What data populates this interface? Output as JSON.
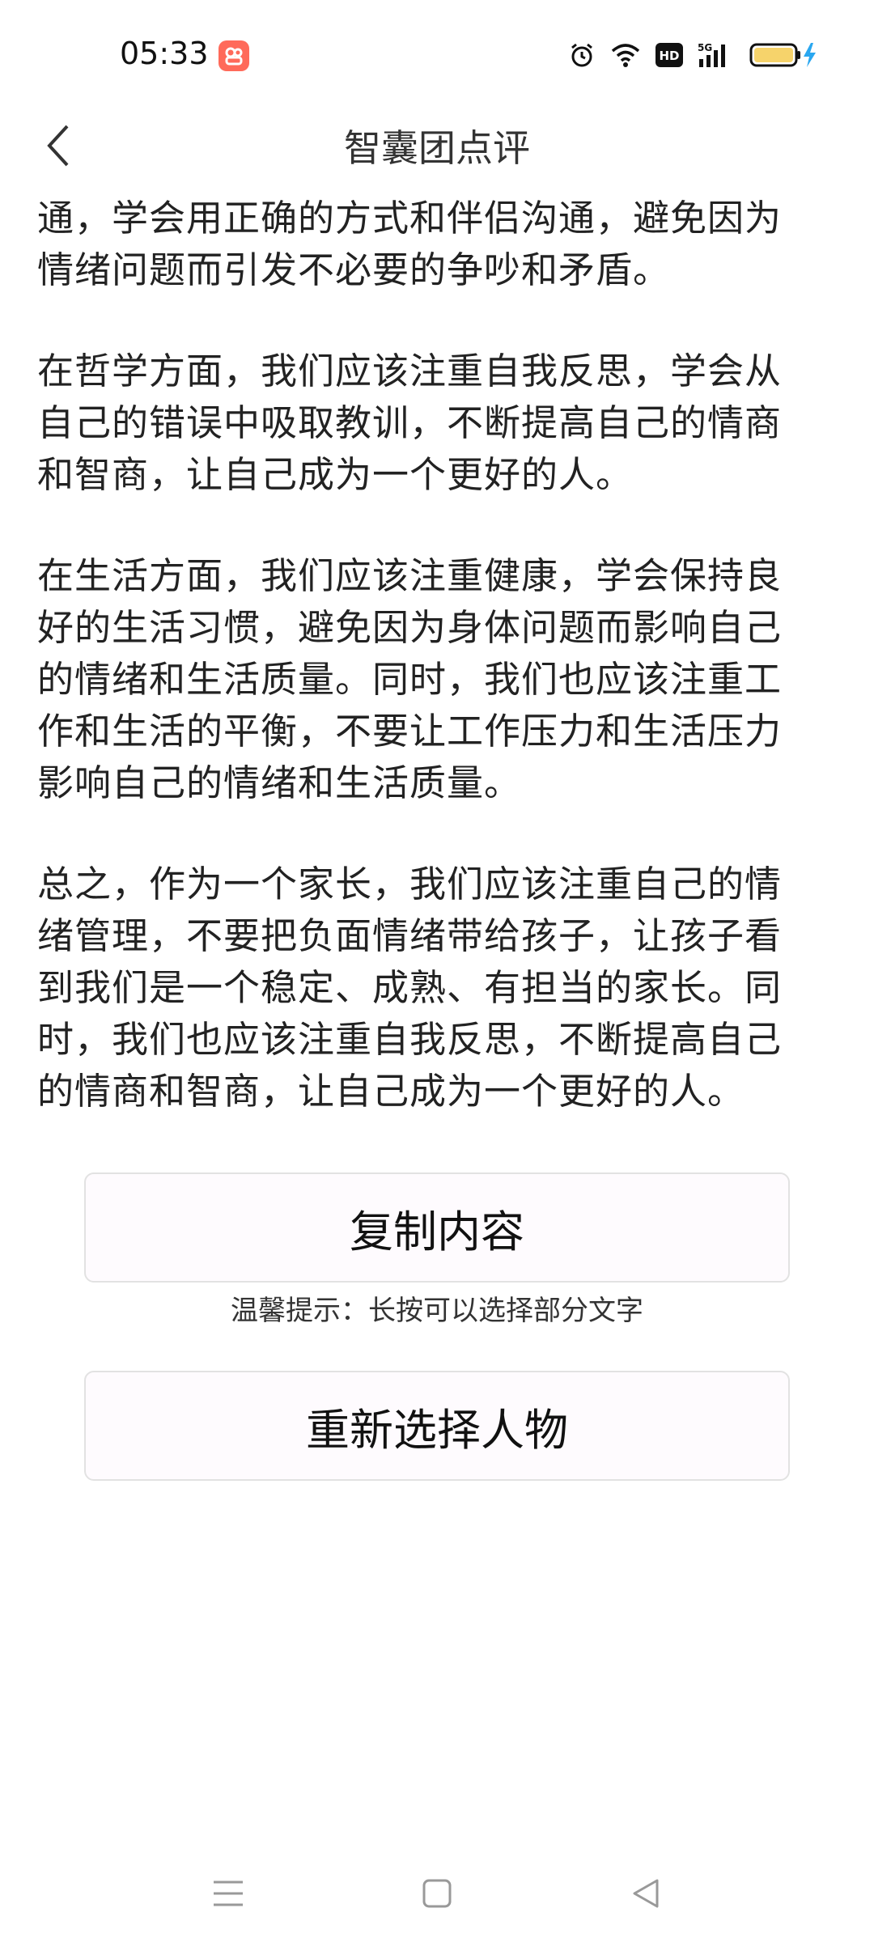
{
  "status_bar": {
    "time": "05:33",
    "network": "5G",
    "hd": "HD",
    "app_badge_color": "#ff6a5a",
    "battery_color": "#f6d36b",
    "charging_color": "#2aa7f0"
  },
  "nav": {
    "title": "智囊团点评"
  },
  "content": {
    "paragraphs": [
      "通，学会用正确的方式和伴侣沟通，避免因为\n情绪问题而引发不必要的争吵和矛盾。",
      "在哲学方面，我们应该注重自我反思，学会从\n自己的错误中吸取教训，不断提高自己的情商\n和智商，让自己成为一个更好的人。",
      "在生活方面，我们应该注重健康，学会保持良\n好的生活习惯，避免因为身体问题而影响自己\n的情绪和生活质量。同时，我们也应该注重工\n作和生活的平衡，不要让工作压力和生活压力\n影响自己的情绪和生活质量。",
      "总之，作为一个家长，我们应该注重自己的情\n绪管理，不要把负面情绪带给孩子，让孩子看\n到我们是一个稳定、成熟、有担当的家长。同\n时，我们也应该注重自我反思，不断提高自己\n的情商和智商，让自己成为一个更好的人。"
    ]
  },
  "actions": {
    "copy_label": "复制内容",
    "hint": "温馨提示：长按可以选择部分文字",
    "reselect_label": "重新选择人物"
  },
  "system_nav": {
    "icons": [
      "menu-icon",
      "home-icon",
      "back-triangle-icon"
    ]
  }
}
